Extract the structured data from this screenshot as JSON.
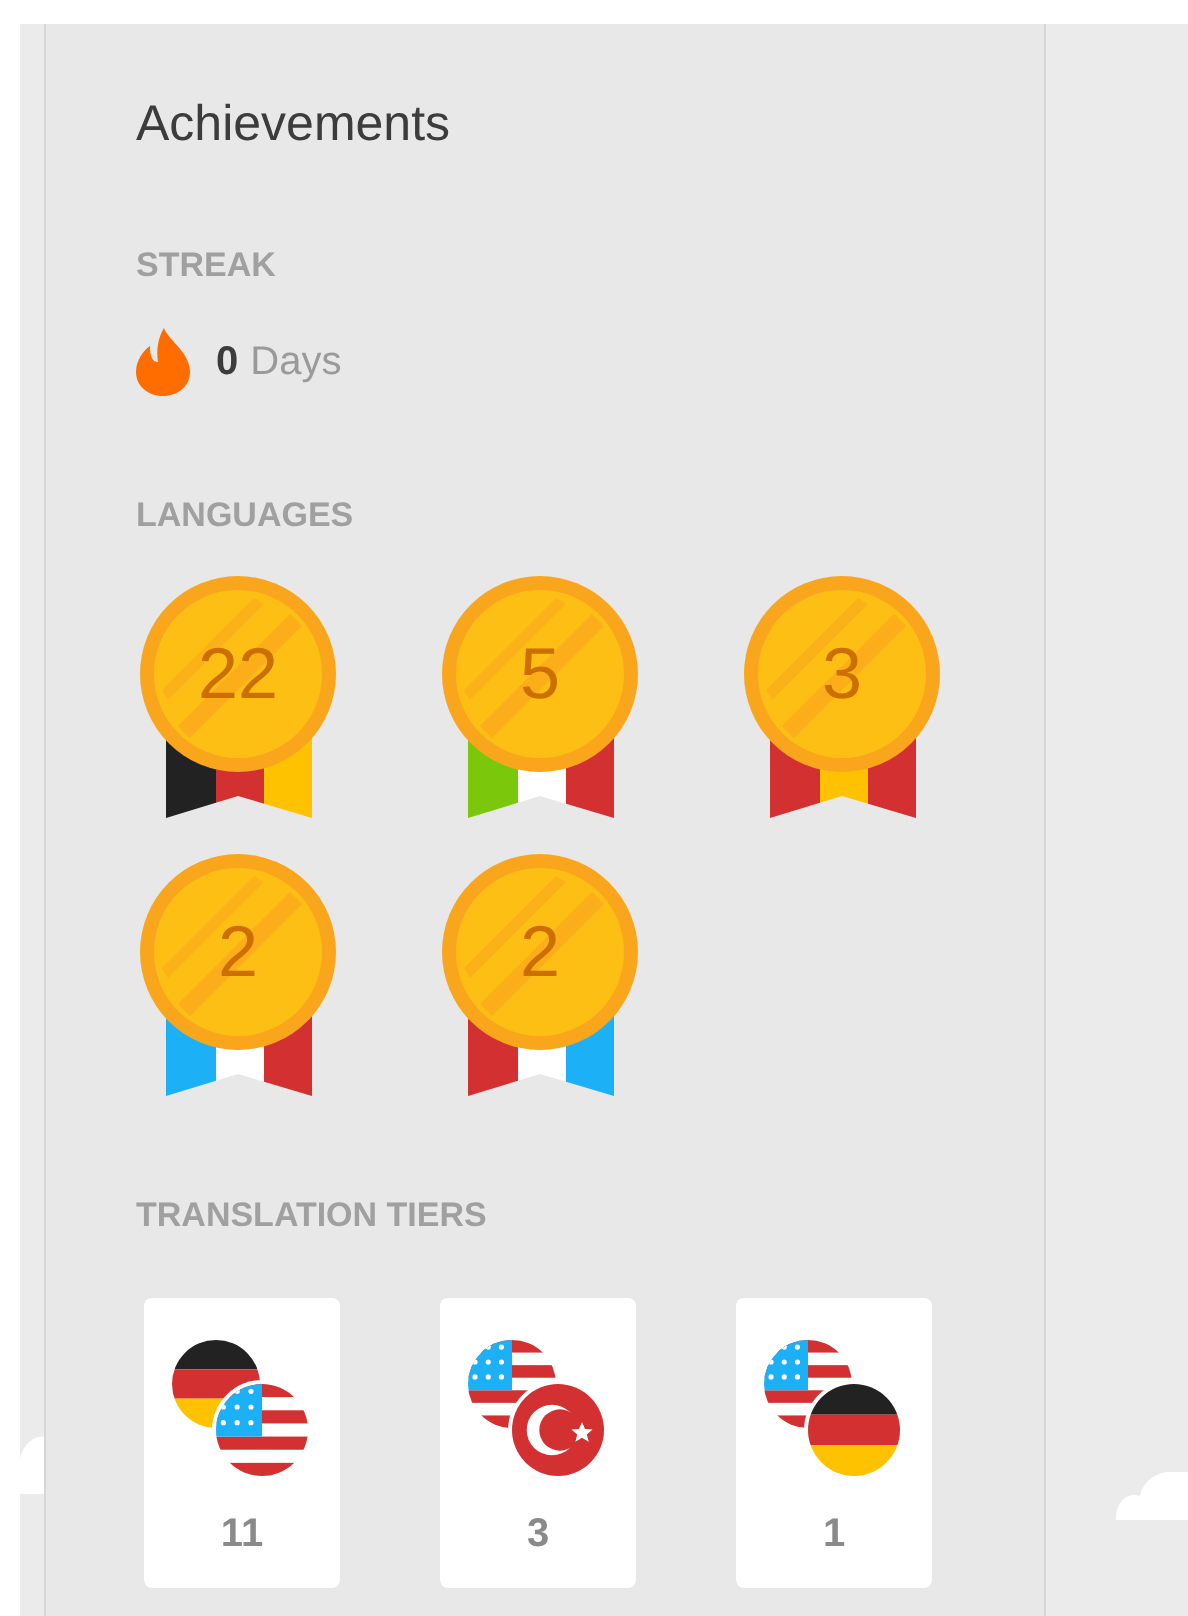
{
  "title": "Achievements",
  "streak": {
    "label": "STREAK",
    "count": "0",
    "unit": "Days"
  },
  "languages": {
    "label": "LANGUAGES",
    "medals": [
      {
        "count": "22",
        "kind": "german"
      },
      {
        "count": "5",
        "kind": "italian"
      },
      {
        "count": "3",
        "kind": "spanish"
      },
      {
        "count": "2",
        "kind": "french"
      },
      {
        "count": "2",
        "kind": "dutch"
      }
    ]
  },
  "translation_tiers": {
    "label": "TRANSLATION TIERS",
    "tiers": [
      {
        "flags": [
          {
            "kind": "german"
          },
          {
            "kind": "english"
          }
        ],
        "count": "11"
      },
      {
        "flags": [
          {
            "kind": "english"
          },
          {
            "kind": "turkish"
          }
        ],
        "count": "3"
      },
      {
        "flags": [
          {
            "kind": "english"
          },
          {
            "kind": "german"
          }
        ],
        "count": "1"
      }
    ]
  }
}
